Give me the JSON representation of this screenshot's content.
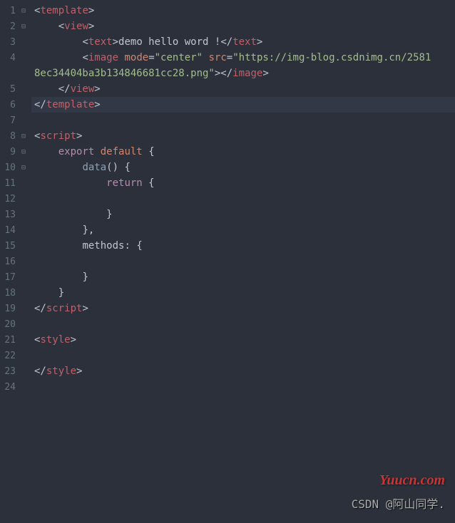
{
  "gutter": {
    "lines": [
      {
        "num": "1",
        "fold": "⊟"
      },
      {
        "num": "2",
        "fold": "⊟"
      },
      {
        "num": "3",
        "fold": ""
      },
      {
        "num": "4",
        "fold": ""
      },
      {
        "num": "5",
        "fold": ""
      },
      {
        "num": "6",
        "fold": ""
      },
      {
        "num": "7",
        "fold": ""
      },
      {
        "num": "8",
        "fold": "⊟"
      },
      {
        "num": "9",
        "fold": "⊟"
      },
      {
        "num": "10",
        "fold": "⊟"
      },
      {
        "num": "11",
        "fold": ""
      },
      {
        "num": "12",
        "fold": ""
      },
      {
        "num": "13",
        "fold": ""
      },
      {
        "num": "14",
        "fold": ""
      },
      {
        "num": "15",
        "fold": ""
      },
      {
        "num": "16",
        "fold": ""
      },
      {
        "num": "17",
        "fold": ""
      },
      {
        "num": "18",
        "fold": ""
      },
      {
        "num": "19",
        "fold": ""
      },
      {
        "num": "20",
        "fold": ""
      },
      {
        "num": "21",
        "fold": ""
      },
      {
        "num": "22",
        "fold": ""
      },
      {
        "num": "23",
        "fold": ""
      },
      {
        "num": "24",
        "fold": ""
      }
    ]
  },
  "code": {
    "l1": {
      "b1": "<",
      "tag": "template",
      "b2": ">"
    },
    "l2": {
      "indent": "    ",
      "b1": "<",
      "tag": "view",
      "b2": ">"
    },
    "l3": {
      "indent": "        ",
      "b1": "<",
      "tag": "text",
      "b2": ">",
      "txt": "demo hello word !",
      "b3": "</",
      "tag2": "text",
      "b4": ">"
    },
    "l4": {
      "indent": "        ",
      "b1": "<",
      "tag": "image",
      "sp": " ",
      "attr1": "mode",
      "eq1": "=",
      "val1": "\"center\"",
      "sp2": " ",
      "attr2": "src",
      "eq2": "=",
      "val2": "\"https://img-blog.csdnimg.cn/2581"
    },
    "l4b": {
      "txt": "8ec34404ba3b134846681cc28.png\"",
      "b1": "></",
      "tag": "image",
      "b2": ">"
    },
    "l5": {
      "indent": "    ",
      "b1": "</",
      "tag": "view",
      "b2": ">"
    },
    "l6": {
      "b1": "</",
      "tag": "template",
      "b2": ">"
    },
    "l8": {
      "b1": "<",
      "tag": "script",
      "b2": ">"
    },
    "l9": {
      "indent": "    ",
      "kw1": "export",
      "sp": " ",
      "kw2": "default",
      "sp2": " ",
      "brace": "{"
    },
    "l10": {
      "indent": "        ",
      "fn": "data",
      "paren": "()",
      "sp": " ",
      "brace": "{"
    },
    "l11": {
      "indent": "            ",
      "kw": "return",
      "sp": " ",
      "brace": "{"
    },
    "l13": {
      "indent": "            ",
      "brace": "}"
    },
    "l14": {
      "indent": "        ",
      "brace": "}",
      "comma": ","
    },
    "l15": {
      "indent": "        ",
      "prop": "methods",
      "colon": ":",
      "sp": " ",
      "brace": "{"
    },
    "l17": {
      "indent": "        ",
      "brace": "}"
    },
    "l18": {
      "indent": "    ",
      "brace": "}"
    },
    "l19": {
      "b1": "</",
      "tag": "script",
      "b2": ">"
    },
    "l21": {
      "b1": "<",
      "tag": "style",
      "b2": ">"
    },
    "l23": {
      "b1": "</",
      "tag": "style",
      "b2": ">"
    }
  },
  "watermark": {
    "red": "Yuucn.com",
    "gray": "CSDN @阿山同学."
  }
}
